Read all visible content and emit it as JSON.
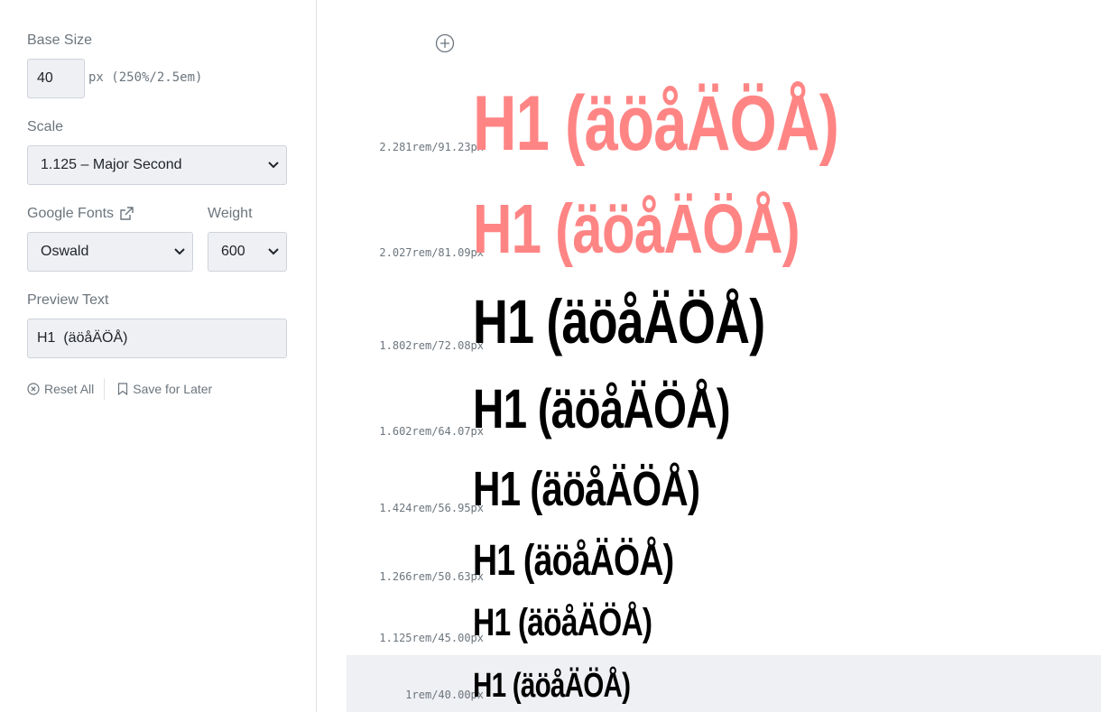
{
  "sidebar": {
    "base_size": {
      "label": "Base Size",
      "value": "40",
      "note": "px (250%/2.5em)"
    },
    "scale": {
      "label": "Scale",
      "value": "1.125 – Major Second"
    },
    "font": {
      "label": "Google Fonts",
      "value": "Oswald",
      "icon": "external-link-icon"
    },
    "weight": {
      "label": "Weight",
      "value": "600"
    },
    "preview": {
      "label": "Preview Text",
      "value": "H1  (äöåÄÖÅ)"
    },
    "reset_label": "Reset All",
    "save_label": "Save for Later"
  },
  "colors": {
    "accent": "#ff8585",
    "text": "#000000",
    "highlight": "#eff0f4"
  },
  "preview": {
    "add_icon": "plus-circle-icon",
    "rows": [
      {
        "size": "2.281rem/91.23px",
        "text": "H1 (äöåÄÖÅ)",
        "color": "accent"
      },
      {
        "size": "2.027rem/81.09px",
        "text": "H1 (äöåÄÖÅ)",
        "color": "accent"
      },
      {
        "size": "1.802rem/72.08px",
        "text": "H1 (äöåÄÖÅ)",
        "color": "text"
      },
      {
        "size": "1.602rem/64.07px",
        "text": "H1 (äöåÄÖÅ)",
        "color": "text"
      },
      {
        "size": "1.424rem/56.95px",
        "text": "H1 (äöåÄÖÅ)",
        "color": "text"
      },
      {
        "size": "1.266rem/50.63px",
        "text": "H1 (äöåÄÖÅ)",
        "color": "text"
      },
      {
        "size": "1.125rem/45.00px",
        "text": "H1 (äöåÄÖÅ)",
        "color": "text"
      },
      {
        "size": "1rem/40.00px",
        "text": "H1 (äöåÄÖÅ)",
        "color": "text",
        "highlighted": true
      }
    ]
  }
}
